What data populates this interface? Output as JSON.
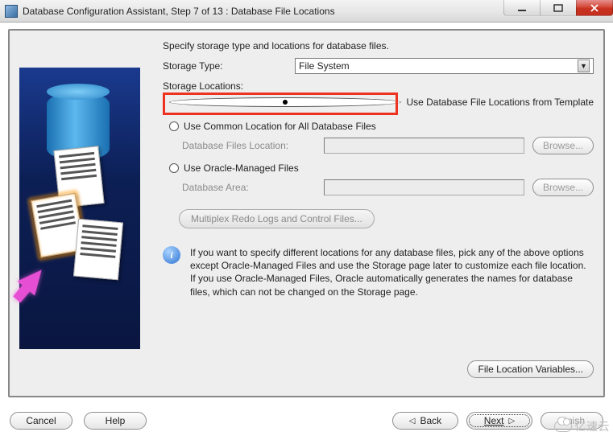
{
  "window": {
    "title": "Database Configuration Assistant, Step 7 of 13 : Database File Locations"
  },
  "main": {
    "intro": "Specify storage type and locations for database files.",
    "storage_type_label": "Storage Type:",
    "storage_type_value": "File System",
    "storage_locations_label": "Storage Locations:",
    "radios": {
      "template": "Use Database File Locations from Template",
      "common": "Use Common Location for All Database Files",
      "omf": "Use Oracle-Managed Files"
    },
    "fields": {
      "db_files_location_label": "Database Files Location:",
      "db_files_location_value": "",
      "db_area_label": "Database Area:",
      "db_area_value": ""
    },
    "browse_label": "Browse...",
    "multiplex_label": "Multiplex Redo Logs and Control Files...",
    "info_text": "If you want to specify different locations for any database files, pick any of the above options except Oracle-Managed Files and use the Storage page later to customize each file location. If you use Oracle-Managed Files, Oracle automatically generates the names for database files, which can not be changed on the Storage page.",
    "file_location_variables": "File Location Variables..."
  },
  "footer": {
    "cancel": "Cancel",
    "help": "Help",
    "back": "Back",
    "next": "Next",
    "finish": "Finish"
  },
  "watermark": "亿速云"
}
